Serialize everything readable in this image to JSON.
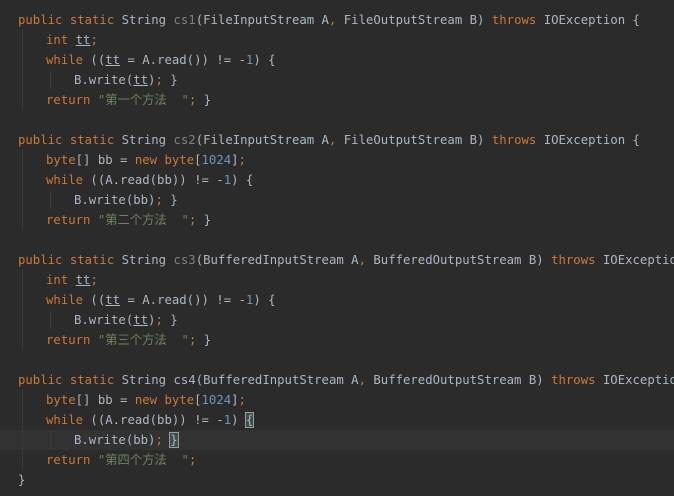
{
  "editor": {
    "lines": [
      {
        "indent": 0,
        "tokens": [
          {
            "t": "public static ",
            "c": "kw"
          },
          {
            "t": "String ",
            "c": "plain"
          },
          {
            "t": "cs1",
            "c": "unused"
          },
          {
            "t": "(FileInputStream A",
            "c": "plain"
          },
          {
            "t": ", ",
            "c": "kw"
          },
          {
            "t": "FileOutputStream B) ",
            "c": "plain"
          },
          {
            "t": "throws ",
            "c": "kw"
          },
          {
            "t": "IOException {",
            "c": "plain"
          }
        ]
      },
      {
        "indent": 1,
        "tokens": [
          {
            "t": "int ",
            "c": "kw"
          },
          {
            "t": "tt",
            "c": "underline"
          },
          {
            "t": ";",
            "c": "kw"
          }
        ]
      },
      {
        "indent": 1,
        "tokens": [
          {
            "t": "while ",
            "c": "kw"
          },
          {
            "t": "((",
            "c": "plain"
          },
          {
            "t": "tt",
            "c": "underline"
          },
          {
            "t": " = A.read()) != -",
            "c": "plain"
          },
          {
            "t": "1",
            "c": "num"
          },
          {
            "t": ") {",
            "c": "plain"
          }
        ]
      },
      {
        "indent": 2,
        "tokens": [
          {
            "t": "B.write(",
            "c": "plain"
          },
          {
            "t": "tt",
            "c": "underline"
          },
          {
            "t": ")",
            "c": "plain"
          },
          {
            "t": "; ",
            "c": "kw"
          },
          {
            "t": "}",
            "c": "plain"
          }
        ]
      },
      {
        "indent": 1,
        "tokens": [
          {
            "t": "return ",
            "c": "kw"
          },
          {
            "t": "\"第一个方法  \"",
            "c": "str"
          },
          {
            "t": "; ",
            "c": "kw"
          },
          {
            "t": "}",
            "c": "plain"
          }
        ]
      },
      {
        "indent": 0,
        "tokens": []
      },
      {
        "indent": 0,
        "tokens": [
          {
            "t": "public static ",
            "c": "kw"
          },
          {
            "t": "String ",
            "c": "plain"
          },
          {
            "t": "cs2",
            "c": "unused"
          },
          {
            "t": "(FileInputStream A",
            "c": "plain"
          },
          {
            "t": ", ",
            "c": "kw"
          },
          {
            "t": "FileOutputStream B) ",
            "c": "plain"
          },
          {
            "t": "throws ",
            "c": "kw"
          },
          {
            "t": "IOException {",
            "c": "plain"
          }
        ]
      },
      {
        "indent": 1,
        "tokens": [
          {
            "t": "byte",
            "c": "kw"
          },
          {
            "t": "[] bb = ",
            "c": "plain"
          },
          {
            "t": "new ",
            "c": "kw"
          },
          {
            "t": "byte",
            "c": "kw"
          },
          {
            "t": "[",
            "c": "plain"
          },
          {
            "t": "1024",
            "c": "num"
          },
          {
            "t": "]",
            "c": "plain"
          },
          {
            "t": ";",
            "c": "kw"
          }
        ]
      },
      {
        "indent": 1,
        "tokens": [
          {
            "t": "while ",
            "c": "kw"
          },
          {
            "t": "((A.read(bb)) != -",
            "c": "plain"
          },
          {
            "t": "1",
            "c": "num"
          },
          {
            "t": ") {",
            "c": "plain"
          }
        ]
      },
      {
        "indent": 2,
        "tokens": [
          {
            "t": "B.write(bb)",
            "c": "plain"
          },
          {
            "t": "; ",
            "c": "kw"
          },
          {
            "t": "}",
            "c": "plain"
          }
        ]
      },
      {
        "indent": 1,
        "tokens": [
          {
            "t": "return ",
            "c": "kw"
          },
          {
            "t": "\"第二个方法  \"",
            "c": "str"
          },
          {
            "t": "; ",
            "c": "kw"
          },
          {
            "t": "}",
            "c": "plain"
          }
        ]
      },
      {
        "indent": 0,
        "tokens": []
      },
      {
        "indent": 0,
        "tokens": [
          {
            "t": "public static ",
            "c": "kw"
          },
          {
            "t": "String ",
            "c": "plain"
          },
          {
            "t": "cs3",
            "c": "unused"
          },
          {
            "t": "(BufferedInputStream A",
            "c": "plain"
          },
          {
            "t": ", ",
            "c": "kw"
          },
          {
            "t": "BufferedOutputStream B) ",
            "c": "plain"
          },
          {
            "t": "throws ",
            "c": "kw"
          },
          {
            "t": "IOException {",
            "c": "plain"
          }
        ]
      },
      {
        "indent": 1,
        "tokens": [
          {
            "t": "int ",
            "c": "kw"
          },
          {
            "t": "tt",
            "c": "underline"
          },
          {
            "t": ";",
            "c": "kw"
          }
        ]
      },
      {
        "indent": 1,
        "tokens": [
          {
            "t": "while ",
            "c": "kw"
          },
          {
            "t": "((",
            "c": "plain"
          },
          {
            "t": "tt",
            "c": "underline"
          },
          {
            "t": " = A.read()) != -",
            "c": "plain"
          },
          {
            "t": "1",
            "c": "num"
          },
          {
            "t": ") {",
            "c": "plain"
          }
        ]
      },
      {
        "indent": 2,
        "tokens": [
          {
            "t": "B.write(",
            "c": "plain"
          },
          {
            "t": "tt",
            "c": "underline"
          },
          {
            "t": ")",
            "c": "plain"
          },
          {
            "t": "; ",
            "c": "kw"
          },
          {
            "t": "}",
            "c": "plain"
          }
        ]
      },
      {
        "indent": 1,
        "tokens": [
          {
            "t": "return ",
            "c": "kw"
          },
          {
            "t": "\"第三个方法  \"",
            "c": "str"
          },
          {
            "t": "; ",
            "c": "kw"
          },
          {
            "t": "}",
            "c": "plain"
          }
        ]
      },
      {
        "indent": 0,
        "tokens": []
      },
      {
        "indent": 0,
        "tokens": [
          {
            "t": "public static ",
            "c": "kw"
          },
          {
            "t": "String ",
            "c": "plain"
          },
          {
            "t": "cs4",
            "c": "plain"
          },
          {
            "t": "(BufferedInputStream A",
            "c": "plain"
          },
          {
            "t": ", ",
            "c": "kw"
          },
          {
            "t": "BufferedOutputStream B) ",
            "c": "plain"
          },
          {
            "t": "throws ",
            "c": "kw"
          },
          {
            "t": "IOException {",
            "c": "plain"
          }
        ]
      },
      {
        "indent": 1,
        "tokens": [
          {
            "t": "byte",
            "c": "kw"
          },
          {
            "t": "[] bb = ",
            "c": "plain"
          },
          {
            "t": "new ",
            "c": "kw"
          },
          {
            "t": "byte",
            "c": "kw"
          },
          {
            "t": "[",
            "c": "plain"
          },
          {
            "t": "1024",
            "c": "num"
          },
          {
            "t": "]",
            "c": "plain"
          },
          {
            "t": ";",
            "c": "kw"
          }
        ]
      },
      {
        "indent": 1,
        "tokens": [
          {
            "t": "while ",
            "c": "kw"
          },
          {
            "t": "((A.read(bb)) != -",
            "c": "plain"
          },
          {
            "t": "1",
            "c": "num"
          },
          {
            "t": ") ",
            "c": "plain"
          },
          {
            "t": "{",
            "c": "match"
          }
        ]
      },
      {
        "indent": 2,
        "current": true,
        "tokens": [
          {
            "t": "B.write(bb)",
            "c": "plain"
          },
          {
            "t": "; ",
            "c": "kw"
          },
          {
            "t": "}",
            "c": "match"
          },
          {
            "t": "",
            "c": "caret"
          }
        ]
      },
      {
        "indent": 1,
        "tokens": [
          {
            "t": "return ",
            "c": "kw"
          },
          {
            "t": "\"第四个方法  \"",
            "c": "str"
          },
          {
            "t": ";",
            "c": "kw"
          }
        ]
      },
      {
        "indent": 0,
        "tokens": [
          {
            "t": "}",
            "c": "plain"
          }
        ]
      }
    ]
  },
  "colors": {
    "background": "#2b2b2b",
    "current_line": "#323232",
    "keyword": "#cc7832",
    "identifier": "#a9b7c6",
    "number": "#6897bb",
    "string": "#6a8759",
    "unused_method": "#808080"
  }
}
